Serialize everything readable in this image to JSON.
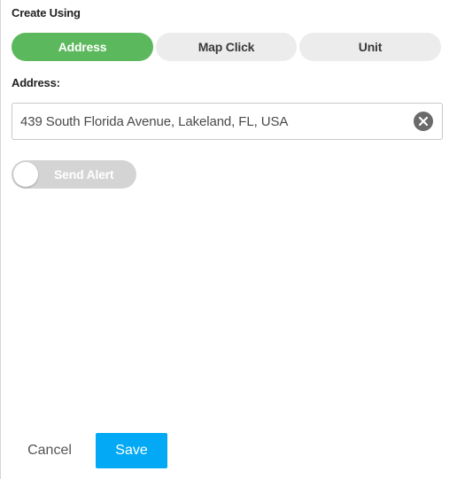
{
  "create_using": {
    "label": "Create Using",
    "options": [
      {
        "label": "Address",
        "active": true
      },
      {
        "label": "Map Click",
        "active": false
      },
      {
        "label": "Unit",
        "active": false
      }
    ]
  },
  "address": {
    "label": "Address:",
    "value": "439 South Florida Avenue, Lakeland, FL, USA",
    "clear_icon": "close-circle-icon"
  },
  "send_alert": {
    "label": "Send Alert",
    "enabled": false
  },
  "actions": {
    "cancel_label": "Cancel",
    "save_label": "Save"
  },
  "colors": {
    "active_segment": "#5cb85c",
    "save_button": "#03a9f4",
    "toggle_off": "#d4d4d4"
  }
}
